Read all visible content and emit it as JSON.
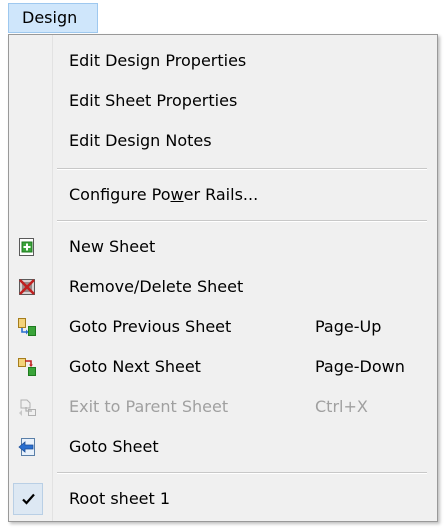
{
  "menubar": {
    "title": "Design"
  },
  "menu": {
    "items": [
      {
        "label": "Edit Design Properties"
      },
      {
        "label": "Edit Sheet Properties"
      },
      {
        "label": "Edit Design Notes"
      },
      {
        "label_before": "Configure Po",
        "label_underlined": "w",
        "label_after": "er Rails..."
      },
      {
        "label": "New Sheet",
        "icon": "new-sheet-icon"
      },
      {
        "label": "Remove/Delete Sheet",
        "icon": "delete-sheet-icon"
      },
      {
        "label": "Goto Previous Sheet",
        "shortcut": "Page-Up",
        "icon": "previous-sheet-icon"
      },
      {
        "label": "Goto Next Sheet",
        "shortcut": "Page-Down",
        "icon": "next-sheet-icon"
      },
      {
        "label": "Exit to Parent Sheet",
        "shortcut": "Ctrl+X",
        "icon": "exit-parent-sheet-icon",
        "disabled": true
      },
      {
        "label": "Goto Sheet",
        "icon": "goto-sheet-icon"
      },
      {
        "label": "Root sheet 1",
        "checked": true,
        "icon": "checkmark-icon"
      }
    ]
  },
  "colors": {
    "menu_background": "#f0f0f0",
    "menubar_highlight": "#cfe6fb",
    "disabled_text": "#a0a0a0"
  }
}
